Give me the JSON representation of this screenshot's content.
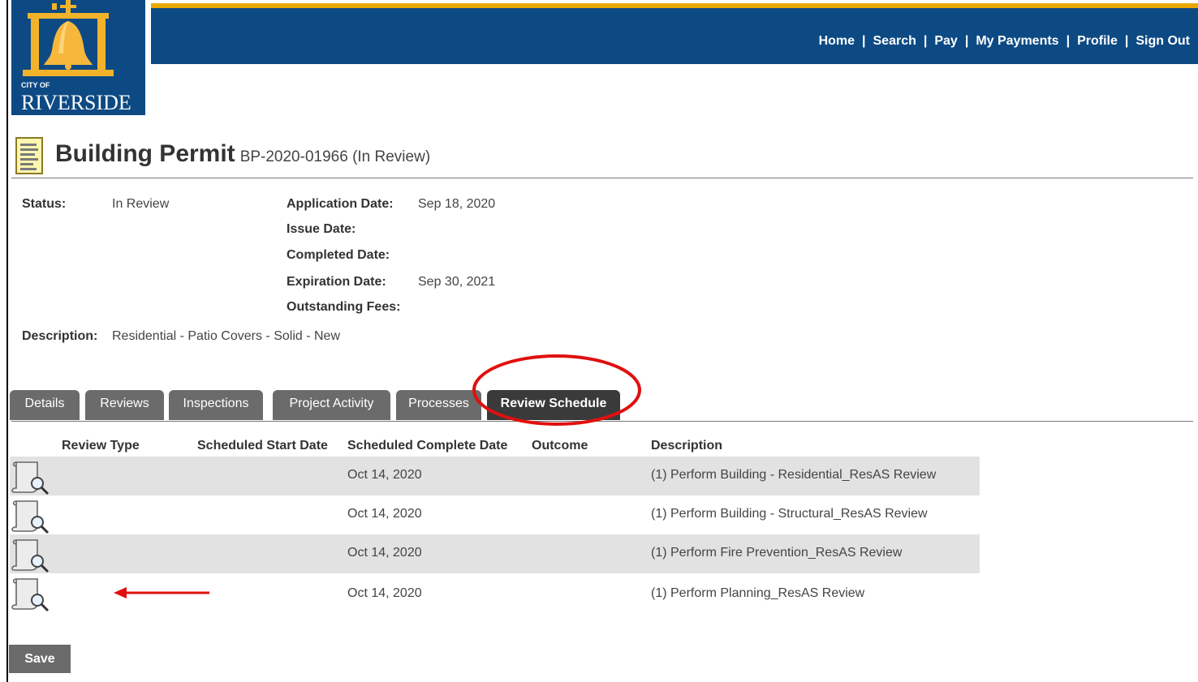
{
  "logo": {
    "city_of": "CITY OF",
    "city": "RIVERSIDE"
  },
  "nav": [
    "Home",
    "Search",
    "Pay",
    "My Payments",
    "Profile",
    "Sign Out"
  ],
  "page": {
    "title": "Building Permit",
    "subtitle": "BP-2020-01966 (In Review)"
  },
  "summary": {
    "status_label": "Status:",
    "status_value": "In Review",
    "application_date_label": "Application Date:",
    "application_date_value": "Sep 18, 2020",
    "issue_date_label": "Issue Date:",
    "completed_date_label": "Completed Date:",
    "expiration_date_label": "Expiration Date:",
    "expiration_date_value": "Sep 30, 2021",
    "outstanding_fees_label": "Outstanding Fees:",
    "description_label": "Description:",
    "description_value": "Residential - Patio Covers - Solid - New"
  },
  "tabs": [
    {
      "label": "Details",
      "active": false
    },
    {
      "label": "Reviews",
      "active": false
    },
    {
      "label": "Inspections",
      "active": false
    },
    {
      "label": "Project Activity",
      "active": false
    },
    {
      "label": "Processes",
      "active": false
    },
    {
      "label": "Review Schedule",
      "active": true
    }
  ],
  "table": {
    "headers": [
      "Review Type",
      "Scheduled Start Date",
      "Scheduled Complete Date",
      "Outcome",
      "Description"
    ],
    "rows": [
      {
        "complete_date": "Oct 14, 2020",
        "description": "(1) Perform Building - Residential_ResAS Review"
      },
      {
        "complete_date": "Oct 14, 2020",
        "description": "(1) Perform Building - Structural_ResAS Review"
      },
      {
        "complete_date": "Oct 14, 2020",
        "description": "(1) Perform Fire Prevention_ResAS Review"
      },
      {
        "complete_date": "Oct 14, 2020",
        "description": "(1) Perform Planning_ResAS Review"
      }
    ]
  },
  "buttons": {
    "save": "Save"
  },
  "colors": {
    "header_blue": "#0d4a84",
    "accent_gold": "#e8a800",
    "tab_gray": "#6b6b6b",
    "tab_active": "#3a3a3a",
    "annotation_red": "#e01010"
  }
}
